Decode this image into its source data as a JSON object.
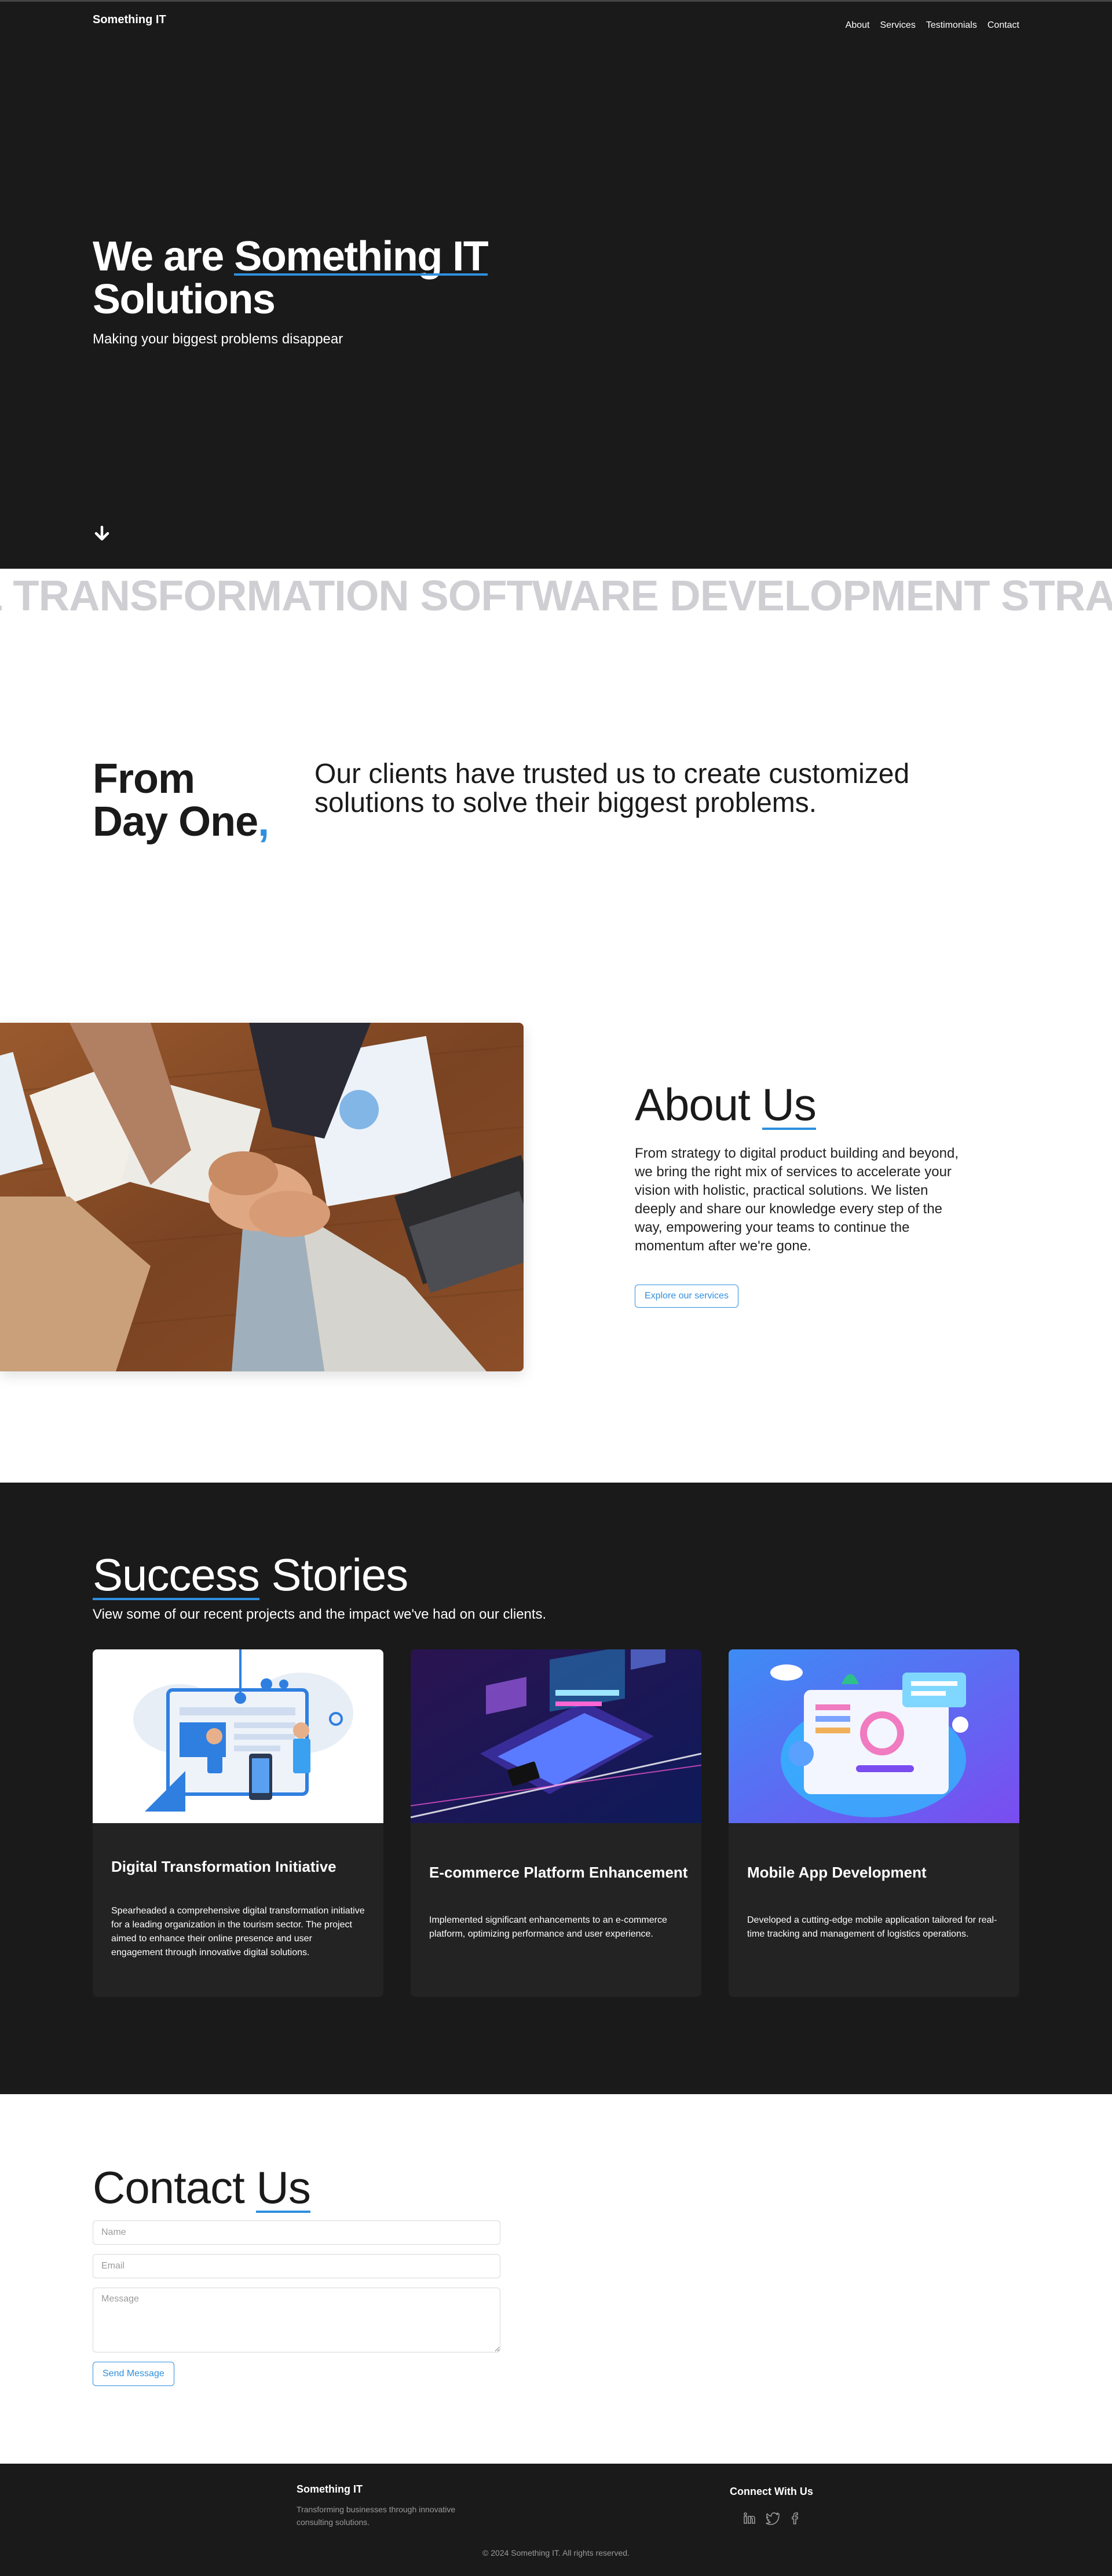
{
  "nav": {
    "brand": "Something IT",
    "links": [
      "About",
      "Services",
      "Testimonials",
      "Contact"
    ]
  },
  "hero": {
    "title_line1_prefix": "We are ",
    "title_line1_highlight": "Something IT",
    "title_line2": "Solutions",
    "tagline": "Making your biggest problems disappear",
    "scroll_icon": "arrow-down-icon"
  },
  "ticker": {
    "text": "L TRANSFORMATION SOFTWARE DEVELOPMENT STRATEGY"
  },
  "intro": {
    "line1": "From",
    "line2": "Day One",
    "comma": ",",
    "statement": "Our clients have trusted us to create customized solutions to solve their biggest problems."
  },
  "about": {
    "title_prefix": "About ",
    "title_highlight": "Us",
    "body": "From strategy to digital product building and beyond, we bring the right mix of services to accelerate your vision with holistic, practical solutions. We listen deeply and share our knowledge every step of the way, empowering your teams to continue the momentum after we're gone.",
    "button": "Explore our services"
  },
  "stories": {
    "title_highlight": "Success",
    "title_suffix": " Stories",
    "subtitle": "View some of our recent projects and the impact we've had on our clients.",
    "cards": [
      {
        "title": "Digital Transformation Initiative",
        "description": "Spearheaded a comprehensive digital transformation initiative for a leading organization in the tourism sector. The project aimed to enhance their online presence and user engagement through innovative digital solutions."
      },
      {
        "title": "E-commerce Platform Enhancement",
        "description": "Implemented significant enhancements to an e-commerce platform, optimizing performance and user experience."
      },
      {
        "title": "Mobile App Development",
        "description": "Developed a cutting-edge mobile application tailored for real-time tracking and management of logistics operations."
      }
    ]
  },
  "contact": {
    "title_prefix": "Contact ",
    "title_highlight": "Us",
    "name_placeholder": "Name",
    "email_placeholder": "Email",
    "message_placeholder": "Message",
    "send": "Send Message"
  },
  "footer": {
    "brand": "Something IT",
    "description": "Transforming businesses through innovative consulting solutions.",
    "connect": "Connect With Us",
    "socials": [
      "linkedin-icon",
      "twitter-icon",
      "facebook-icon"
    ],
    "copyright": "© 2024 Something IT. All rights reserved."
  },
  "colors": {
    "dark": "#1a1a1a",
    "accent": "#2f8fde",
    "card": "#232323",
    "ticker": "#cfcfd3"
  }
}
